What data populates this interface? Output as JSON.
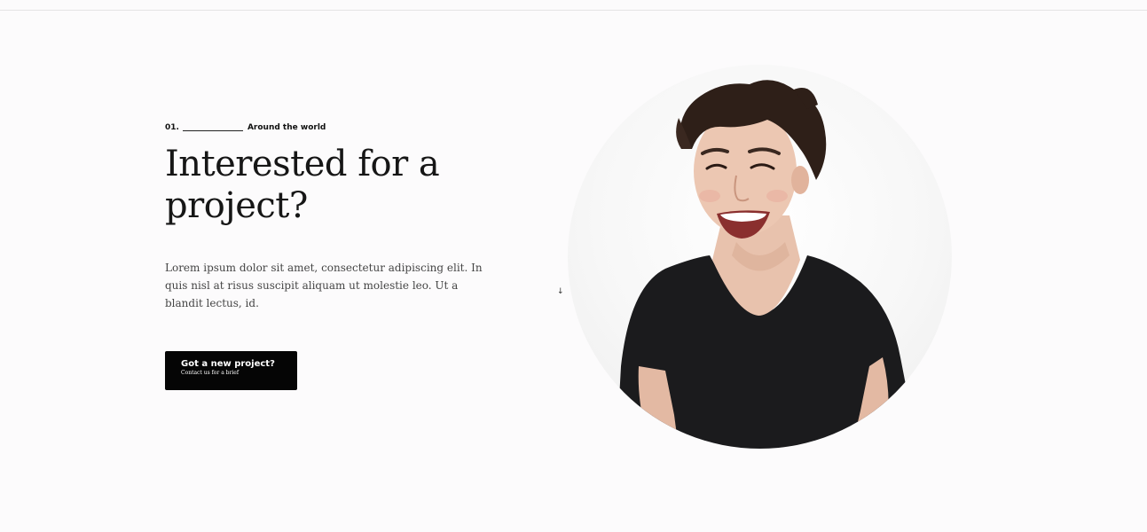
{
  "hero": {
    "eyebrow_number": "01.",
    "eyebrow_label": "Around the world",
    "headline": "Interested for a project?",
    "body": "Lorem ipsum dolor sit amet, consectetur adipiscing elit. In quis nisl at risus suscipit aliquam ut molestie leo. Ut a blandit lectus, id.",
    "cta": {
      "title": "Got a new project?",
      "subtitle": "Contact us for a brief"
    },
    "scroll_icon": "down-arrow-icon"
  },
  "portrait": {
    "icon": "portrait-photo",
    "colors": {
      "shirt": "#1b1b1d",
      "skin": "#e8c2ad",
      "hair": "#2e1f18",
      "background": "#f4f4f4"
    }
  }
}
